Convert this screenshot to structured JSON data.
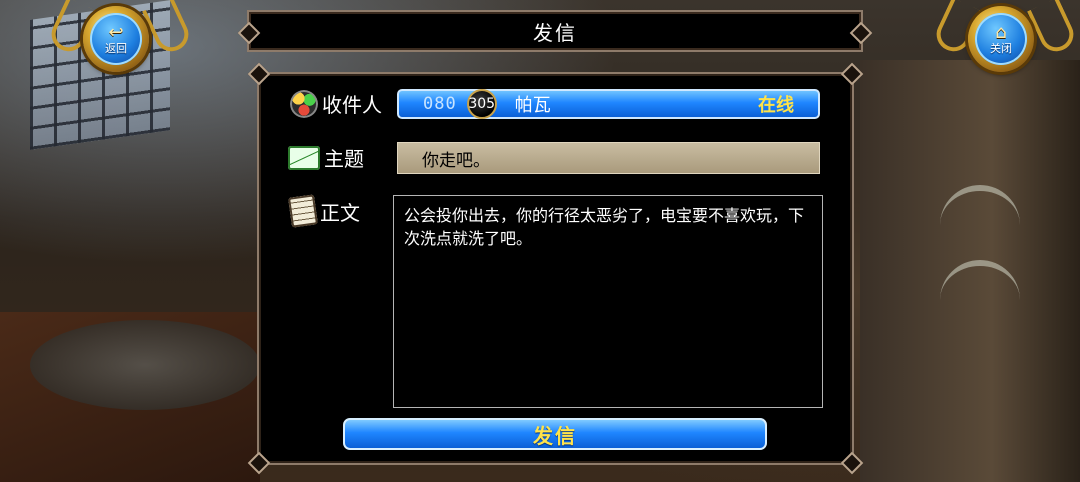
{
  "nav": {
    "back_label": "返回",
    "close_label": "关闭",
    "back_icon": "back-arrow-icon",
    "close_icon": "home-icon"
  },
  "title": "发信",
  "recipient": {
    "label": "收件人",
    "level_code": "080",
    "level": "305",
    "name": "帕瓦",
    "status": "在线"
  },
  "subject": {
    "label": "主题",
    "value": "你走吧。"
  },
  "body": {
    "label": "正文",
    "value": "公会投你出去，你的行径太恶劣了，电宝要不喜欢玩，下次洗点就洗了吧。"
  },
  "send_label": "发信",
  "colors": {
    "button_blue": "#1f86ff",
    "highlight_yellow": "#ffe34a",
    "frame_border": "#8e7b6a",
    "subject_bg": "#b3a688"
  }
}
